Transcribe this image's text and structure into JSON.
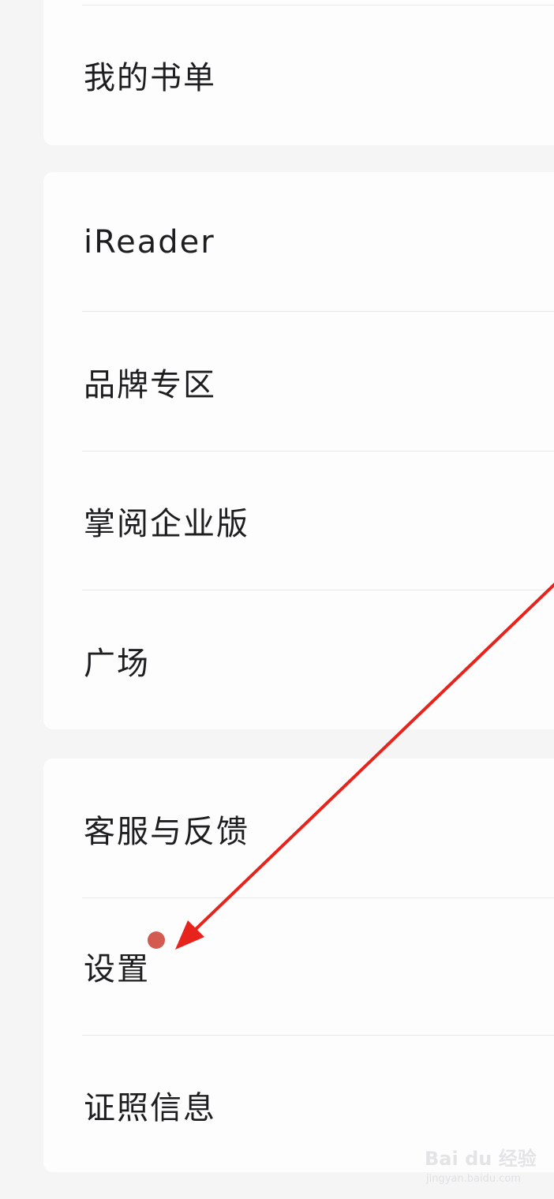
{
  "groups": [
    {
      "items": [
        {
          "label": "我的书单"
        }
      ]
    },
    {
      "items": [
        {
          "label": "iReader"
        },
        {
          "label": "品牌专区"
        },
        {
          "label": "掌阅企业版"
        },
        {
          "label": "广场"
        }
      ]
    },
    {
      "items": [
        {
          "label": "客服与反馈"
        },
        {
          "label": "设置",
          "badge": "red-dot"
        },
        {
          "label": "证照信息"
        }
      ]
    }
  ],
  "annotation": {
    "arrow_color": "#e8231b",
    "points_to": "设置"
  },
  "watermark": {
    "main": "Bai du 经验",
    "sub": "jingyan.baidu.com"
  },
  "colors": {
    "background": "#f5f5f6",
    "card": "#fdfdfd",
    "text": "#1e1e20",
    "divider": "#e8e8ea",
    "badge": "#d35a50"
  }
}
